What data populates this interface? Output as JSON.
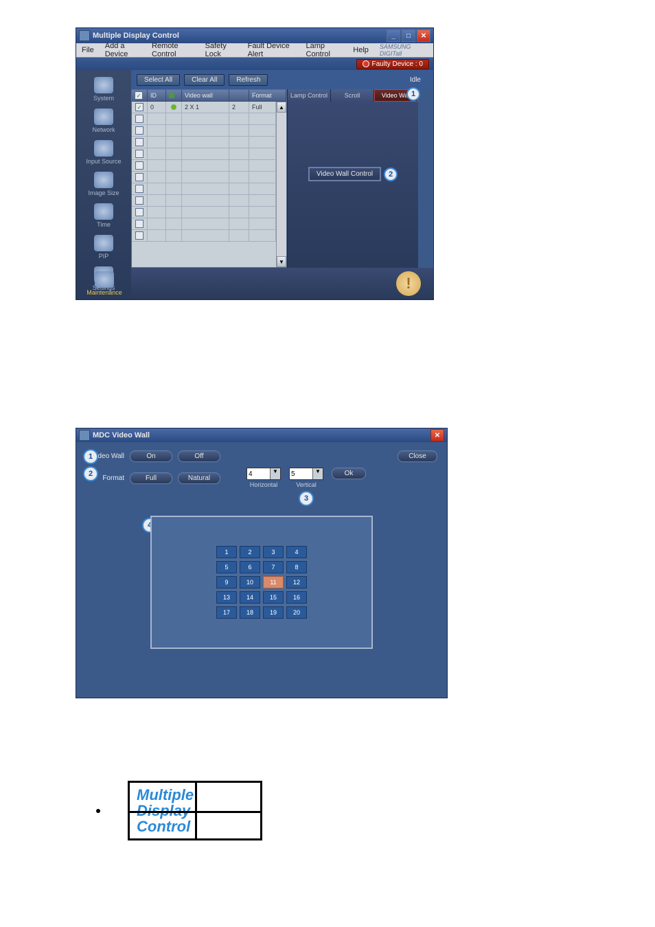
{
  "win1": {
    "title": "Multiple Display Control",
    "menu": [
      "File",
      "Add a Device",
      "Remote Control",
      "Safety Lock",
      "Fault Device Alert",
      "Lamp Control",
      "Help"
    ],
    "brand": "SAMSUNG DIGITall",
    "faulty": "Faulty Device : 0",
    "toolbar": {
      "select_all": "Select All",
      "clear_all": "Clear All",
      "refresh": "Refresh",
      "idle": "Idle"
    },
    "sidebar": [
      {
        "label": "System"
      },
      {
        "label": "Network"
      },
      {
        "label": "Input Source"
      },
      {
        "label": "Image Size"
      },
      {
        "label": "Time"
      },
      {
        "label": "PIP"
      },
      {
        "label": "Settings"
      }
    ],
    "maintenance": "Maintenance",
    "grid_headers": {
      "chk": "✓",
      "id": "ID",
      "st": "●",
      "vw": "Video wall",
      "div": "",
      "fmt": "Format"
    },
    "grid_row": {
      "id": "0",
      "vw": "2 X 1",
      "div": "2",
      "fmt": "Full"
    },
    "tabs": {
      "lamp": "Lamp Control",
      "scroll": "Scroll",
      "vw": "Video Wall"
    },
    "vwc_btn": "Video Wall Control",
    "callout1": "1",
    "callout2": "2"
  },
  "win2": {
    "title": "MDC Video Wall",
    "rows": {
      "videowall": {
        "label": "Video Wall",
        "on": "On",
        "off": "Off"
      },
      "format": {
        "label": "Format",
        "full": "Full",
        "natural": "Natural"
      }
    },
    "close": "Close",
    "ok": "Ok",
    "horiz": {
      "val": "4",
      "label": "Horizontal"
    },
    "vert": {
      "val": "5",
      "label": "Vertical"
    },
    "matrix_selected": 11,
    "callouts": {
      "c1": "1",
      "c2": "2",
      "c3": "3",
      "c4": "4"
    }
  },
  "mdc": {
    "l1": "Multiple",
    "l2": "Display",
    "l3": "Control"
  }
}
